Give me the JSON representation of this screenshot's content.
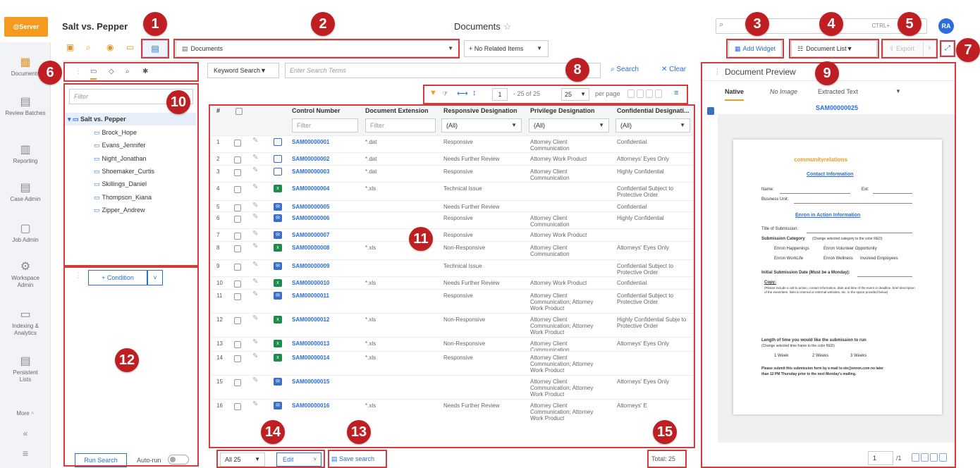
{
  "header": {
    "logo": "@Server",
    "case_name": "Salt vs. Pepper",
    "page_title": "Documents",
    "shortcut": "CTRL+",
    "avatar": "RA"
  },
  "nav": [
    {
      "label": "Documents",
      "icon": "documents-icon",
      "glyph": "▦"
    },
    {
      "label": "Review Batches",
      "icon": "review-batches-icon",
      "glyph": "▤"
    },
    {
      "label": "Reporting",
      "icon": "reporting-icon",
      "glyph": "▥"
    },
    {
      "label": "Case Admin",
      "icon": "case-admin-icon",
      "glyph": "▤"
    },
    {
      "label": "Job Admin",
      "icon": "job-admin-icon",
      "glyph": "▢"
    },
    {
      "label": "Workspace Admin",
      "icon": "workspace-admin-icon",
      "glyph": "⚙"
    },
    {
      "label": "Indexing & Analytics",
      "icon": "indexing-icon",
      "glyph": "▭"
    },
    {
      "label": "Persistent Lists",
      "icon": "persistent-lists-icon",
      "glyph": "▤"
    },
    {
      "label": "More",
      "icon": "more-icon",
      "glyph": ""
    }
  ],
  "toolbar": {
    "view_select": "Documents",
    "related_select": "+ No Related Items",
    "add_widget": "Add Widget",
    "document_list": "Document List",
    "export": "Export"
  },
  "browser": {
    "filter_placeholder": "Filter",
    "root": "Salt vs. Pepper",
    "folders": [
      "Brock_Hope",
      "Evans_Jennifer",
      "Night_Jonathan",
      "Shoemaker_Curtis",
      "Skillings_Daniel",
      "Thompson_Kiana",
      "Zipper_Andrew"
    ],
    "condition_button": "+ Condition",
    "run_search": "Run Search",
    "autorun": "Auto-run"
  },
  "search": {
    "mode": "Keyword Search",
    "placeholder": "Enter Search Terms",
    "search_label": "Search",
    "clear_label": "Clear"
  },
  "pagination": {
    "page": "1",
    "range": "- 25 of 25",
    "per_page": "25",
    "per_page_label": "per page"
  },
  "grid": {
    "headers": [
      "#",
      "Control Number",
      "Document Extension",
      "Responsive Designation",
      "Privilege Designation",
      "Confidential Designati..."
    ],
    "filters": [
      "Filter",
      "Filter",
      "(All)",
      "(All)",
      "(All)"
    ],
    "rows": [
      {
        "n": "1",
        "type": "file",
        "ctrl": "SAM00000001",
        "ext": "*.dat",
        "resp": "Responsive",
        "priv": "Attorney Client Communication",
        "conf": "Confidential"
      },
      {
        "n": "2",
        "type": "file",
        "ctrl": "SAM00000002",
        "ext": "*.dat",
        "resp": "Needs Further Review",
        "priv": "Attorney Work Product",
        "conf": "Attorneys' Eyes Only"
      },
      {
        "n": "3",
        "type": "file",
        "ctrl": "SAM00000003",
        "ext": "*.dat",
        "resp": "Responsive",
        "priv": "Attorney Client Communication",
        "conf": "Highly Confidential"
      },
      {
        "n": "4",
        "type": "xls",
        "ctrl": "SAM00000004",
        "ext": "*.xls",
        "resp": "Technical Issue",
        "priv": "",
        "conf": "Confidential Subject to Protective Order"
      },
      {
        "n": "5",
        "type": "msg",
        "ctrl": "SAM00000005",
        "ext": "",
        "resp": "Needs Further Review",
        "priv": "",
        "conf": "Confidential"
      },
      {
        "n": "6",
        "type": "msg",
        "ctrl": "SAM00000006",
        "ext": "",
        "resp": "Responsive",
        "priv": "Attorney Client Communication",
        "conf": "Highly Confidential"
      },
      {
        "n": "7",
        "type": "msg",
        "ctrl": "SAM00000007",
        "ext": "",
        "resp": "Responsive",
        "priv": "Attorney Work Product",
        "conf": ""
      },
      {
        "n": "8",
        "type": "xls",
        "ctrl": "SAM00000008",
        "ext": "*.xls",
        "resp": "Non-Responsive",
        "priv": "Attorney Client Communication",
        "conf": "Attorneys' Eyes Only"
      },
      {
        "n": "9",
        "type": "msg",
        "ctrl": "SAM00000009",
        "ext": "",
        "resp": "Technical Issue",
        "priv": "",
        "conf": "Confidential Subject to Protective Order"
      },
      {
        "n": "10",
        "type": "xls",
        "ctrl": "SAM00000010",
        "ext": "*.xls",
        "resp": "Needs Further Review",
        "priv": "Attorney Work Product",
        "conf": "Confidential"
      },
      {
        "n": "11",
        "type": "msg",
        "ctrl": "SAM00000011",
        "ext": "",
        "resp": "Responsive",
        "priv": "Attorney Client Communication; Attorney Work Product",
        "conf": "Confidential Subject to Protective Order"
      },
      {
        "n": "12",
        "type": "xls",
        "ctrl": "SAM00000012",
        "ext": "*.xls",
        "resp": "Non-Responsive",
        "priv": "Attorney Client Communication; Attorney Work Product",
        "conf": "Highly Confidential Subje to Protective Order"
      },
      {
        "n": "13",
        "type": "xls",
        "ctrl": "SAM00000013",
        "ext": "*.xls",
        "resp": "Non-Responsive",
        "priv": "Attorney Client Communication",
        "conf": "Attorneys' Eyes Only"
      },
      {
        "n": "14",
        "type": "xls",
        "ctrl": "SAM00000014",
        "ext": "*.xls",
        "resp": "Responsive",
        "priv": "Attorney Client Communication; Attorney Work Product",
        "conf": ""
      },
      {
        "n": "15",
        "type": "msg",
        "ctrl": "SAM00000015",
        "ext": "",
        "resp": "",
        "priv": "Attorney Client Communication; Attorney Work Product",
        "conf": "Attorneys' Eyes Only"
      },
      {
        "n": "16",
        "type": "msg",
        "ctrl": "SAM00000016",
        "ext": "*.xls",
        "resp": "Needs Further Review",
        "priv": "Attorney Client Communication; Attorney Work Product",
        "conf": "Attorneys' E"
      }
    ]
  },
  "bottom": {
    "all_select": "All 25",
    "edit_select": "Edit",
    "save_search": "Save search",
    "total": "Total: 25"
  },
  "preview": {
    "title": "Document Preview",
    "tabs": [
      "Native",
      "No Image",
      "Extracted Text"
    ],
    "control_number": "SAM00000025",
    "doc_logo": "communityrelations",
    "doc_heading1": "Contact Information",
    "doc_name": "Name:",
    "doc_ext": "Ext:",
    "doc_bu": "Business Unit:",
    "doc_heading2": "Enron in Action Information",
    "doc_title_sub": "Title of Submission:",
    "doc_category": "Submission Category",
    "doc_cat_note": "(Change selected category to the color RED)",
    "doc_opt1": "Enron Happenings",
    "doc_opt2": "Enron Volunteer Opportunity",
    "doc_opt3": "Enron WorkLife",
    "doc_opt4": "Enron Wellness",
    "doc_opt5": "Involved Employees",
    "doc_initial": "Initial Submission Date (Must be a Monday):",
    "doc_copy": "Copy:",
    "doc_copy_note": "(Please include a call to action, contact information, date and time of the event or deadline, brief description of the event/item, links to internal or external websites, etc. in the space provided below)",
    "doc_length": "Length of time you would like the submission to run",
    "doc_length_note": "(Change selected time frame to the color RED)",
    "doc_w1": "1 Week",
    "doc_w2": "2 Weeks",
    "doc_w3": "3 Weeks",
    "doc_submit": "Please submit this submission form by e-mail to eie@enron.com no later",
    "doc_submit2": "than 12 PM Thursday prior to the next Monday's mailing.",
    "page_num": "1",
    "page_of": "/1"
  },
  "callouts": [
    "1",
    "2",
    "3",
    "4",
    "5",
    "6",
    "7",
    "8",
    "9",
    "10",
    "11",
    "12",
    "13",
    "14",
    "15"
  ],
  "colors": {
    "accent": "#2a6ed9",
    "brand": "#f39a1f",
    "callout": "#bf1f22",
    "frame": "#d33c3c"
  }
}
